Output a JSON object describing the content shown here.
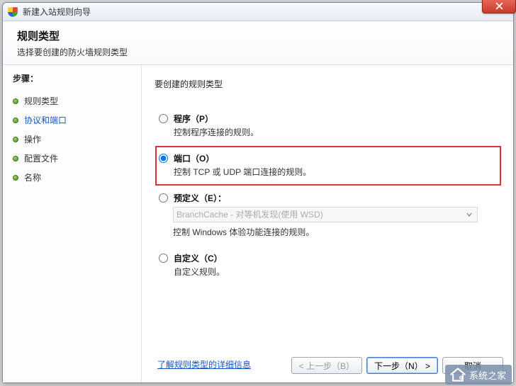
{
  "window": {
    "title": "新建入站规则向导"
  },
  "header": {
    "title": "规则类型",
    "subtitle": "选择要创建的防火墙规则类型"
  },
  "sidebar": {
    "stepsHeading": "步骤：",
    "items": [
      {
        "label": "规则类型",
        "active": false
      },
      {
        "label": "协议和端口",
        "active": true
      },
      {
        "label": "操作",
        "active": false
      },
      {
        "label": "配置文件",
        "active": false
      },
      {
        "label": "名称",
        "active": false
      }
    ]
  },
  "content": {
    "prompt": "要创建的规则类型",
    "options": {
      "program": {
        "label": "程序（P）",
        "desc": "控制程序连接的规则。",
        "checked": false
      },
      "port": {
        "label": "端口（O）",
        "desc": "控制 TCP 或 UDP 端口连接的规则。",
        "checked": true,
        "highlight": true
      },
      "predefined": {
        "label": "预定义（E）：",
        "desc": "控制 Windows 体验功能连接的规则。",
        "checked": false,
        "selectValue": "BranchCache - 对等机发现(使用 WSD)",
        "selectDisabled": true
      },
      "custom": {
        "label": "自定义（C）",
        "desc": "自定义规则。",
        "checked": false
      }
    },
    "learnMoreLink": "了解规则类型的详细信息"
  },
  "footer": {
    "back": "< 上一步（B）",
    "next": "下一步（N） >",
    "cancel": "取消"
  },
  "watermark": "系统之家"
}
